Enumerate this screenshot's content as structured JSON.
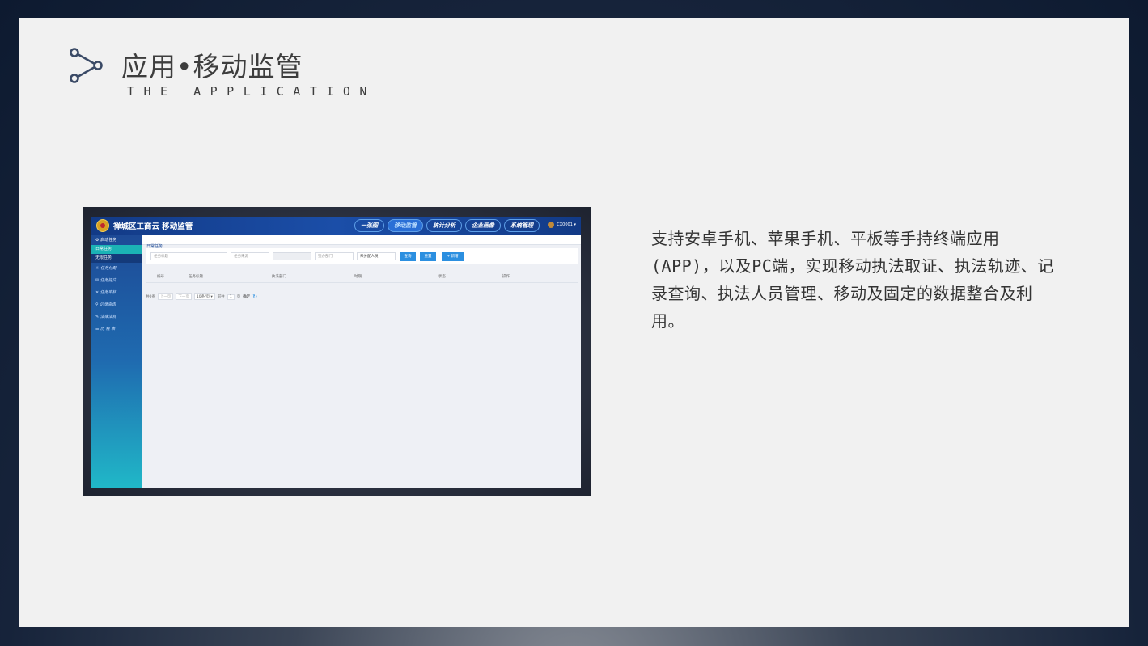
{
  "slide": {
    "title": "应用•移动监管",
    "subtitle": "THE APPLICATION",
    "description": "支持安卓手机、苹果手机、平板等手持终端应用(APP)，以及PC端，实现移动执法取证、执法轨迹、记录查询、执法人员管理、移动及固定的数据整合及利用。"
  },
  "screenshot": {
    "app_title": "禅城区工商云  移动监管",
    "nav": [
      "一张图",
      "移动监管",
      "统计分析",
      "企业画像",
      "系统管理"
    ],
    "nav_active": "移动监管",
    "user": "CX0001 ▾",
    "sidebar": {
      "section": "启动任务",
      "sub_items": [
        "日常任务",
        "无限任务"
      ],
      "items": [
        "任务分配",
        "任务提交",
        "任务审核",
        "记录查询",
        "法律法规",
        "历 程 表"
      ]
    },
    "tab": "日常任务",
    "filters": {
      "title_placeholder": "任务标题",
      "source_placeholder": "任务来源",
      "dept_placeholder": "签办部门",
      "person_placeholder": "未分配人员",
      "query_button": "查询",
      "reset_button": "重置",
      "add_button": "+ 新增"
    },
    "table_headers": [
      "编号",
      "任务标题",
      "执法部门",
      "时期",
      "状态",
      "操作"
    ],
    "pager": {
      "total": "共0条",
      "prev": "上一页",
      "next": "下一页",
      "page_size": "10条/页 ▾",
      "goto_label": "前往",
      "goto_value": "1",
      "page_unit": "页",
      "confirm": "确定"
    }
  },
  "colors": {
    "slide_bg": "#f1f1f1",
    "header_blue": "#1b4ea8",
    "accent_button": "#2b8fe0",
    "sidebar_active": "#1bb3b5"
  }
}
